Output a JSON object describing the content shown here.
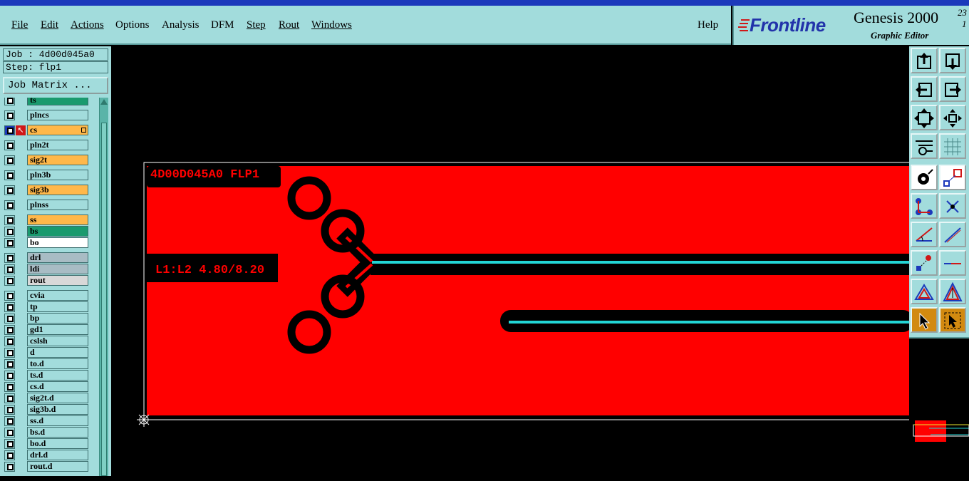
{
  "menu": {
    "file": "File",
    "edit": "Edit",
    "actions": "Actions",
    "options": "Options",
    "analysis": "Analysis",
    "dfm": "DFM",
    "step": "Step",
    "rout": "Rout",
    "windows": "Windows",
    "help": "Help"
  },
  "brand": {
    "logo": "Frontline",
    "product": "Genesis 2000",
    "version_top": "23",
    "version_bottom": "1",
    "subtitle": "Graphic Editor"
  },
  "job_label": "Job : 4d00d045a0",
  "step_label": "Step: flp1",
  "job_matrix_button": "Job Matrix ...",
  "layers": [
    {
      "name": "ts",
      "color": "#1a9a6e"
    },
    {
      "name": "plncs",
      "color": "#a2dcdc"
    },
    {
      "name": "cs",
      "color": "#ffb84a",
      "active": true
    },
    {
      "name": "pln2t",
      "color": "#a2dcdc"
    },
    {
      "name": "sig2t",
      "color": "#ffb84a"
    },
    {
      "name": "pln3b",
      "color": "#a2dcdc"
    },
    {
      "name": "sig3b",
      "color": "#ffb84a"
    },
    {
      "name": "plnss",
      "color": "#a2dcdc"
    },
    {
      "name": "ss",
      "color": "#ffb84a"
    },
    {
      "name": "bs",
      "color": "#1a9a6e"
    },
    {
      "name": "bo",
      "color": "#ffffff"
    },
    {
      "name": "drl",
      "color": "#a8bcc4"
    },
    {
      "name": "ldi",
      "color": "#a8bcc4"
    },
    {
      "name": "rout",
      "color": "#d8d8d8"
    },
    {
      "name": "cvia",
      "color": "#a2dcdc"
    },
    {
      "name": "tp",
      "color": "#a2dcdc"
    },
    {
      "name": "bp",
      "color": "#a2dcdc"
    },
    {
      "name": "gd1",
      "color": "#a2dcdc"
    },
    {
      "name": "cslsh",
      "color": "#a2dcdc"
    },
    {
      "name": "d",
      "color": "#a2dcdc"
    },
    {
      "name": "to.d",
      "color": "#a2dcdc"
    },
    {
      "name": "ts.d",
      "color": "#a2dcdc"
    },
    {
      "name": "cs.d",
      "color": "#a2dcdc"
    },
    {
      "name": "sig2t.d",
      "color": "#a2dcdc"
    },
    {
      "name": "sig3b.d",
      "color": "#a2dcdc"
    },
    {
      "name": "ss.d",
      "color": "#a2dcdc"
    },
    {
      "name": "bs.d",
      "color": "#a2dcdc"
    },
    {
      "name": "bo.d",
      "color": "#a2dcdc"
    },
    {
      "name": "drl.d",
      "color": "#a2dcdc"
    },
    {
      "name": "rout.d",
      "color": "#a2dcdc"
    }
  ],
  "canvas": {
    "board_text": "4D00D045A0 FLP1",
    "layer_text": "L1:L2 4.80/8.20",
    "copper_color": "#ff0000",
    "trace_color": "#22d6d6"
  },
  "toolbar_icons": [
    "move-up-icon",
    "move-down-icon",
    "move-left-icon",
    "move-right-icon",
    "zoom-fit-icon",
    "zoom-pan-icon",
    "measure-tool-icon",
    "grid-icon",
    "pad-icon",
    "select-shape-icon",
    "net-icon",
    "delete-x-icon",
    "angle-icon",
    "line-icon",
    "snap-icon",
    "cut-line-icon",
    "triangle-icon",
    "triangle-arrow-icon",
    "pointer-icon",
    "pointer-box-icon"
  ]
}
